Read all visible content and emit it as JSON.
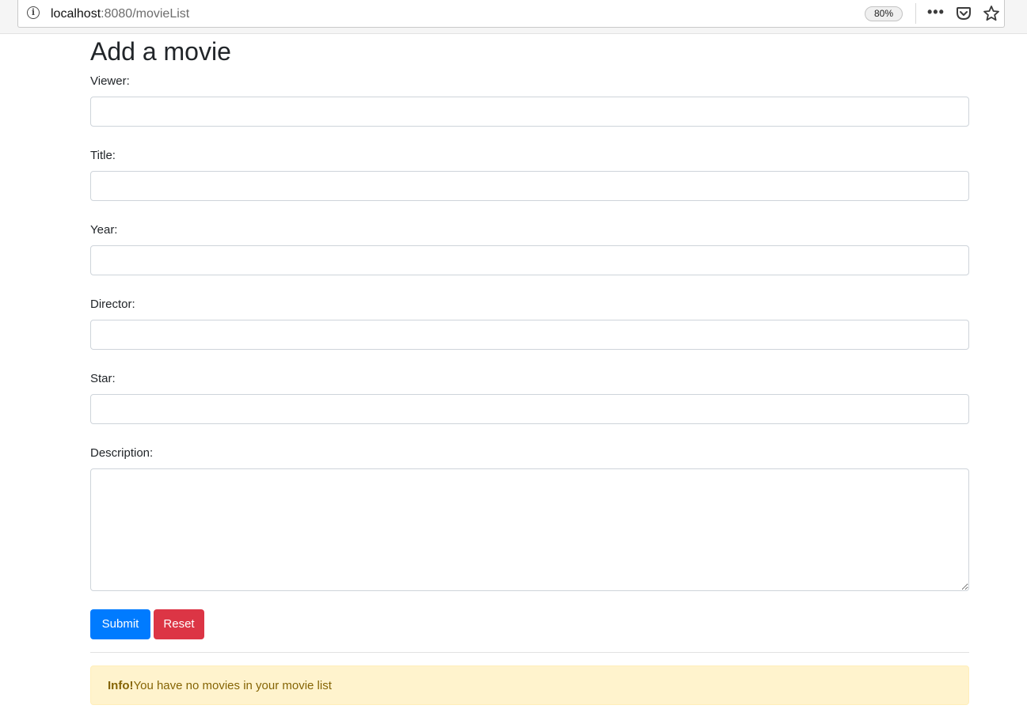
{
  "browser": {
    "url_host": "localhost",
    "url_rest": ":8080/movieList",
    "zoom": "80%"
  },
  "page": {
    "title": "Add a movie",
    "fields": {
      "viewer": {
        "label": "Viewer:",
        "value": ""
      },
      "title": {
        "label": "Title:",
        "value": ""
      },
      "year": {
        "label": "Year:",
        "value": ""
      },
      "director": {
        "label": "Director:",
        "value": ""
      },
      "star": {
        "label": "Star:",
        "value": ""
      },
      "description": {
        "label": "Description:",
        "value": ""
      }
    },
    "buttons": {
      "submit": "Submit",
      "reset": "Reset"
    },
    "alert": {
      "strong": "Info!",
      "text": "You have no movies in your movie list"
    }
  },
  "colors": {
    "primary": "#007bff",
    "danger": "#dc3545",
    "alert_bg": "#fff3cd",
    "alert_text": "#856404"
  }
}
